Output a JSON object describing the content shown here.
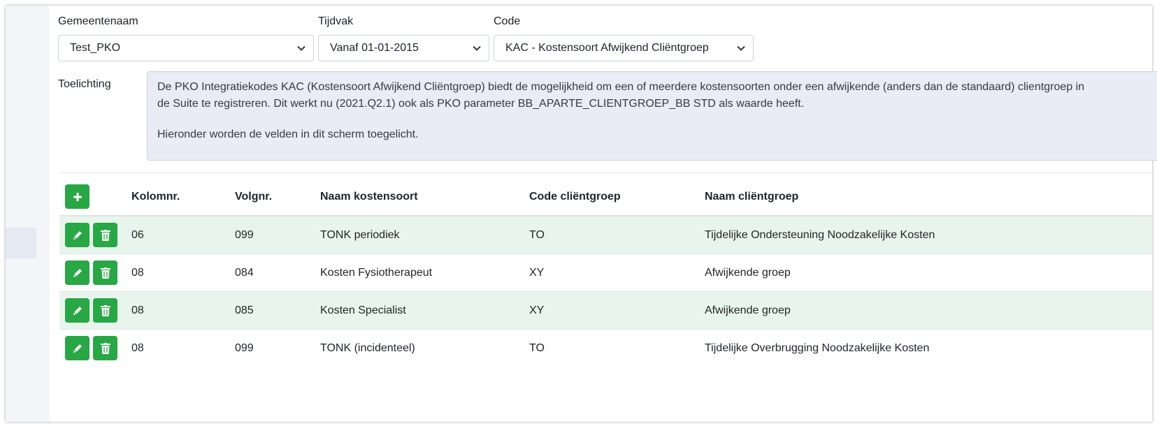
{
  "filters": {
    "gemeente": {
      "label": "Gemeentenaam",
      "value": "Test_PKO"
    },
    "tijdvak": {
      "label": "Tijdvak",
      "value": "Vanaf 01-01-2015"
    },
    "code": {
      "label": "Code",
      "value": "KAC - Kostensoort Afwijkend Cliëntgroep"
    }
  },
  "toelichting": {
    "label": "Toelichting",
    "line1": "De PKO Integratiekodes KAC (Kostensoort Afwijkend Cliëntgroep) biedt de mogelijkheid om een of meerdere kostensoorten onder een afwijkende (anders dan de standaard) clientgroep in",
    "line2": "de Suite te registreren. Dit werkt nu (2021.Q2.1) ook als PKO parameter BB_APARTE_CLIENTGROEP_BB STD als waarde heeft.",
    "line3": "Hieronder worden de velden in dit scherm toegelicht."
  },
  "table": {
    "headers": {
      "kolomnr": "Kolomnr.",
      "volgnr": "Volgnr.",
      "naam_kostensoort": "Naam kostensoort",
      "code_clientgroep": "Code cliëntgroep",
      "naam_clientgroep": "Naam cliëntgroep"
    },
    "rows": [
      {
        "kolomnr": "06",
        "volgnr": "099",
        "naam_kostensoort": "TONK periodiek",
        "code_clientgroep": "TO",
        "naam_clientgroep": "Tijdelijke Ondersteuning Noodzakelijke Kosten"
      },
      {
        "kolomnr": "08",
        "volgnr": "084",
        "naam_kostensoort": "Kosten Fysiotherapeut",
        "code_clientgroep": "XY",
        "naam_clientgroep": "Afwijkende groep"
      },
      {
        "kolomnr": "08",
        "volgnr": "085",
        "naam_kostensoort": "Kosten Specialist",
        "code_clientgroep": "XY",
        "naam_clientgroep": "Afwijkende groep"
      },
      {
        "kolomnr": "08",
        "volgnr": "099",
        "naam_kostensoort": "TONK (incidenteel)",
        "code_clientgroep": "TO",
        "naam_clientgroep": "Tijdelijke Overbrugging Noodzakelijke Kosten"
      }
    ]
  },
  "icons": {
    "add": "plus-icon",
    "edit": "pencil-icon",
    "delete": "trash-icon",
    "dropdown": "chevron-down-icon"
  },
  "colors": {
    "button_green": "#28a745",
    "row_stripe": "#e8f5ec",
    "textarea_bg": "#e9ecf4"
  }
}
